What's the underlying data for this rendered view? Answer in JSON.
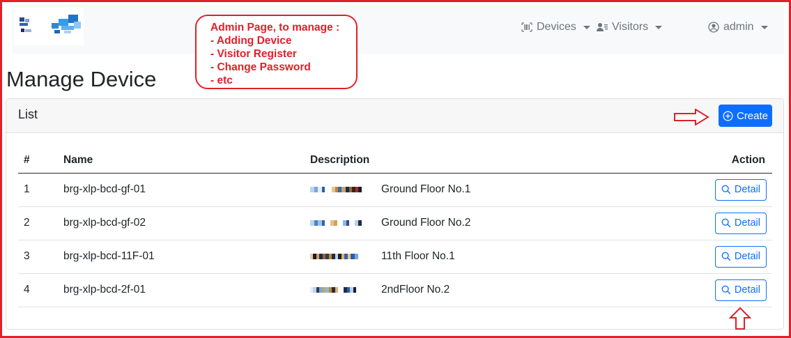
{
  "nav": {
    "devices_label": "Devices",
    "visitors_label": "Visitors",
    "user_label": "admin"
  },
  "callout": {
    "lines": [
      "Admin Page, to manage :",
      "- Adding Device",
      "- Visitor Register",
      "- Change Password",
      "- etc"
    ]
  },
  "page": {
    "title": "Manage Device"
  },
  "card": {
    "title": "List",
    "create_label": "Create"
  },
  "table": {
    "headers": [
      "#",
      "Name",
      "Description",
      "Action"
    ],
    "rows": [
      {
        "num": "1",
        "name": "brg-xlp-bcd-gf-01",
        "desc": "Ground Floor No.1",
        "action": "Detail"
      },
      {
        "num": "2",
        "name": "brg-xlp-bcd-gf-02",
        "desc": "Ground Floor No.2",
        "action": "Detail"
      },
      {
        "num": "3",
        "name": "brg-xlp-bcd-11F-01",
        "desc": "11th Floor No.1",
        "action": "Detail"
      },
      {
        "num": "4",
        "name": "brg-xlp-bcd-2f-01",
        "desc": "2ndFloor No.2",
        "action": "Detail"
      }
    ]
  },
  "colors": {
    "accent": "#0d6efd",
    "annotation": "#e0202a",
    "navbar_bg": "#f8f9fa"
  }
}
